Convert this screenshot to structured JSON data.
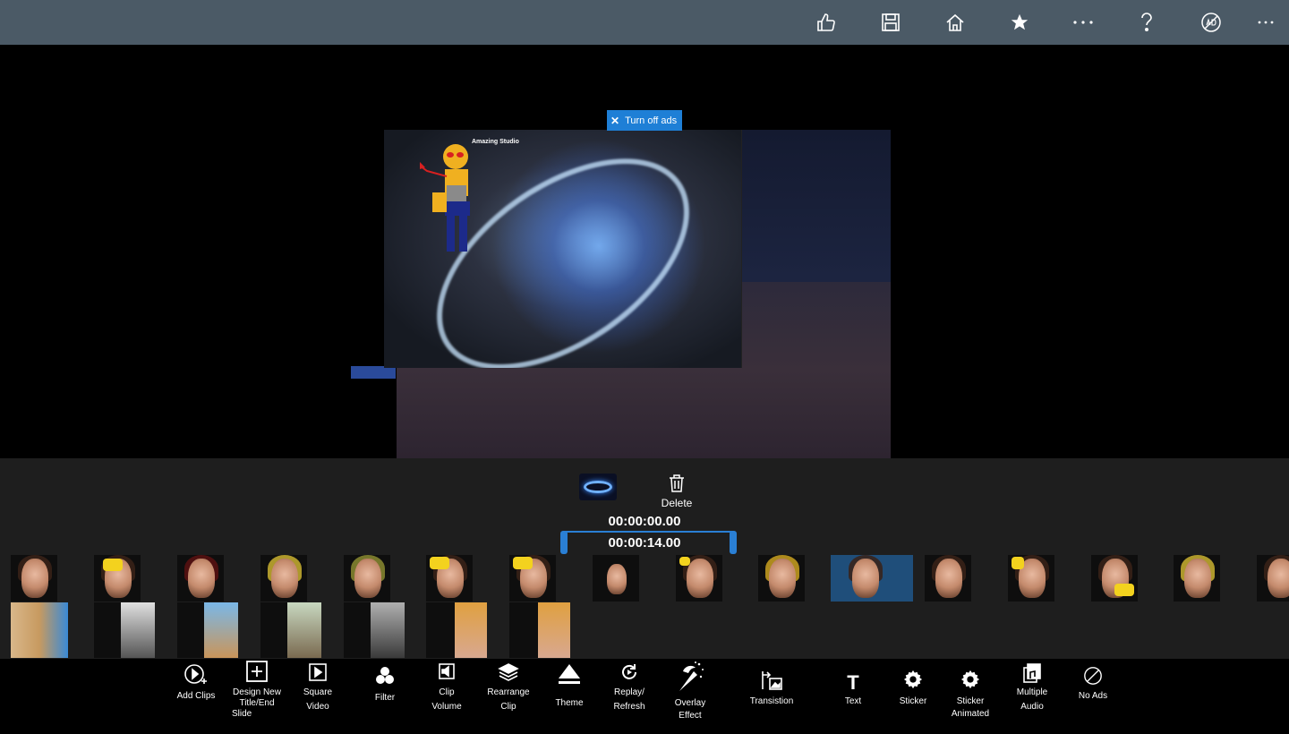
{
  "topbar": {
    "icons": [
      "thumbs-up-icon",
      "save-icon",
      "home-icon",
      "star-icon",
      "more-icon",
      "help-icon",
      "no-ads-icon",
      "overflow-icon"
    ]
  },
  "stage": {
    "ads_banner": "Turn off ads",
    "studio_label": "Amazing Studio"
  },
  "editor": {
    "delete_label": "Delete",
    "time_start": "00:00:00.00",
    "time_end": "00:00:14.00"
  },
  "toolbar": {
    "add_clips": "Add Clips",
    "design_new_1": "Design New",
    "design_new_2": "Title/End",
    "design_new_3": "Slide",
    "square_1": "Square",
    "square_2": "Video",
    "filter": "Filter",
    "clip_volume_1": "Clip",
    "clip_volume_2": "Volume",
    "rearrange_1": "Rearrange",
    "rearrange_2": "Clip",
    "theme": "Theme",
    "replay_1": "Replay/",
    "replay_2": "Refresh",
    "overlay_1": "Overlay",
    "overlay_2": "Effect",
    "transition": "Transistion",
    "text": "Text",
    "sticker": "Sticker",
    "sticker_animated_1": "Sticker",
    "sticker_animated_2": "Animated",
    "multiple_audio_1": "Multiple",
    "multiple_audio_2": "Audio",
    "no_ads": "No Ads"
  }
}
